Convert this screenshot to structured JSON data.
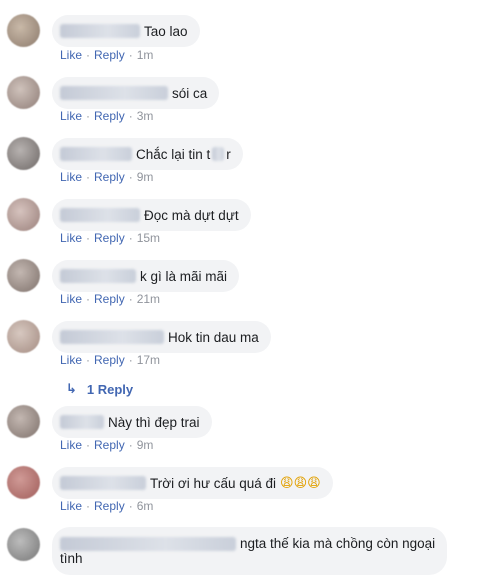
{
  "labels": {
    "like": "Like",
    "reply": "Reply",
    "dot": "·"
  },
  "comments": [
    {
      "text": "Tao lao",
      "time": "1m"
    },
    {
      "text": "sói ca",
      "time": "3m"
    },
    {
      "text": "Chắc lại tin t",
      "text_tail": "r",
      "time": "9m"
    },
    {
      "text": "Đọc mà dựt dựt",
      "time": "15m"
    },
    {
      "text": "k gì là mãi mãi",
      "time": "21m"
    },
    {
      "text": "Hok tin dau ma",
      "time": "17m"
    },
    {
      "text": "Này thì đẹp trai",
      "time": "9m"
    },
    {
      "text": "Trời ơi hư cấu quá đi",
      "emoji": "😩😩😩",
      "time": "6m"
    },
    {
      "text": "ngta thế kia mà chồng còn ngoại",
      "text_line2": "tình"
    }
  ],
  "replies_link": {
    "arrow": "↳",
    "label": "1 Reply"
  }
}
